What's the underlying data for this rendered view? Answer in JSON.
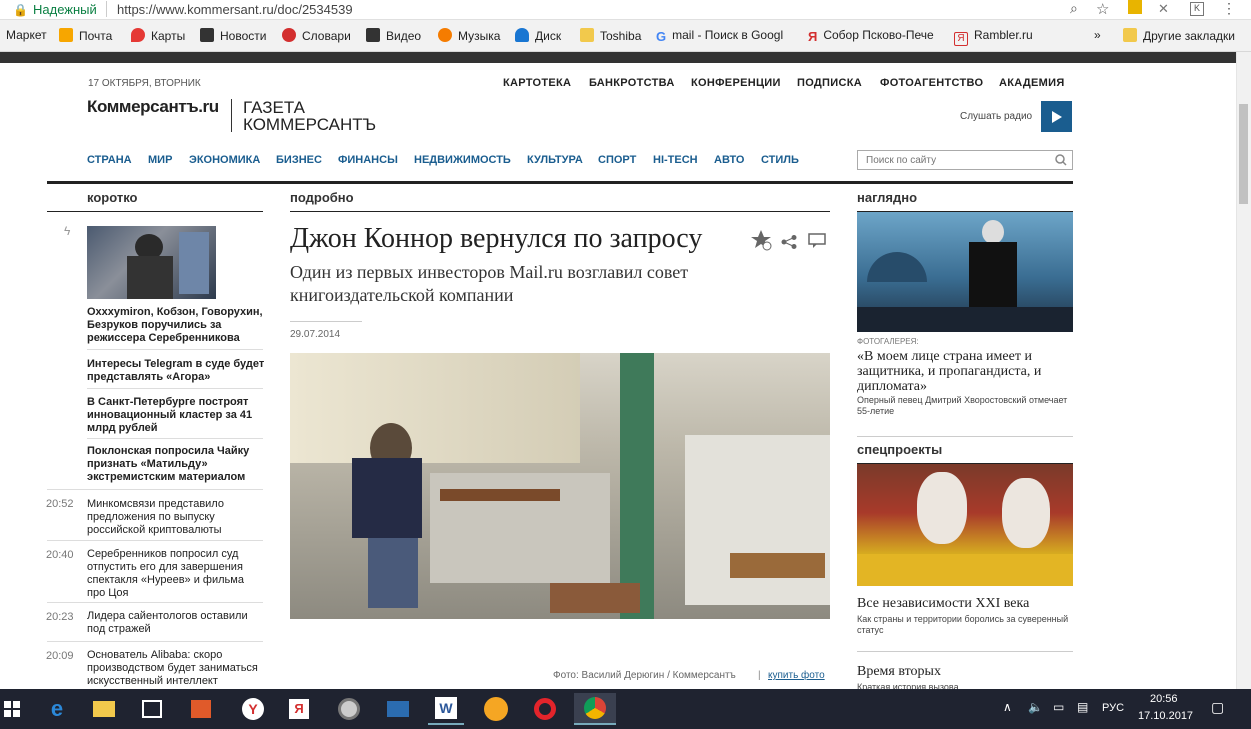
{
  "browser": {
    "secure_label": "Надежный",
    "url": "https://www.kommersant.ru/doc/2534539",
    "bookmarks": [
      "Маркет",
      "Почта",
      "Карты",
      "Новости",
      "Словари",
      "Видео",
      "Музыка",
      "Диск",
      "Toshiba",
      "mail - Поиск в Googl",
      "Собор Псково-Пече",
      "Rambler.ru"
    ],
    "more": "»",
    "other": "Другие закладки"
  },
  "site": {
    "date": "17 ОКТЯБРЯ, ВТОРНИК",
    "logo1": "Коммерсантъ.ru",
    "logo2a": "ГАЗЕТА",
    "logo2b": "КОММЕРСАНТЪ",
    "radio_label": "Слушать радио",
    "top_nav": [
      "КАРТОТЕКА",
      "БАНКРОТСТВА",
      "КОНФЕРЕНЦИИ",
      "ПОДПИСКА",
      "ФОТОАГЕНТСТВО",
      "АКАДЕМИЯ"
    ],
    "main_nav": [
      "СТРАНА",
      "МИР",
      "ЭКОНОМИКА",
      "БИЗНЕС",
      "ФИНАНСЫ",
      "НЕДВИЖИМОСТЬ",
      "КУЛЬТУРА",
      "СПОРТ",
      "HI-TECH",
      "АВТО",
      "СТИЛЬ"
    ],
    "search_placeholder": "Поиск по сайту"
  },
  "left": {
    "heading": "коротко",
    "headline_items": [
      "Oxxxymiron, Кобзон, Говорухин, Безруков поручились за режиссера Серебренникова",
      "Интересы Telegram в суде будет представлять «Агора»",
      "В Санкт-Петербурге построят инновационный кластер за 41 млрд рублей",
      "Поклонская попросила Чайку признать «Матильду» экстремистским материалом"
    ],
    "timed_items": [
      {
        "time": "20:52",
        "text": "Минкомсвязи представило предложения по выпуску российской криптовалюты"
      },
      {
        "time": "20:40",
        "text": "Серебренников попросил суд отпустить его для завершения спектакля «Нуреев» и фильма про Цоя"
      },
      {
        "time": "20:23",
        "text": "Лидера сайентологов оставили под стражей"
      },
      {
        "time": "20:09",
        "text": "Основатель Alibaba: скоро производством будет заниматься искусственный интеллект"
      }
    ]
  },
  "article": {
    "heading": "подробно",
    "title": "Джон Коннор вернулся по запросу",
    "subtitle": "Один из первых инвесторов Mail.ru возглавил совет книгоиздательской компании",
    "date": "29.07.2014",
    "photo_credit": "Фото: Василий Дерюгин / Коммерсантъ",
    "buy_photo": "купить фото",
    "separator": "|"
  },
  "right": {
    "heading": "наглядно",
    "gallery_label": "ФОТОГАЛЕРЕЯ:",
    "gallery_title": "«В моем лице страна имеет и защитника, и пропагандиста, и дипломата»",
    "gallery_desc": "Оперный певец Дмитрий Хворостовский отмечает 55-летие",
    "special_heading": "спецпроекты",
    "special_title": "Все независимости XXI века",
    "special_desc": "Как страны и территории боролись за суверенный статус",
    "special2_title": "Время вторых",
    "special2_desc": "Краткая история вызова"
  },
  "taskbar": {
    "lang": "РУС",
    "time": "20:56",
    "date": "17.10.2017"
  },
  "colors": {
    "nav_blue": "#1a5d8f",
    "radio_button": "#1a5d8f",
    "taskbar": "#1f2330"
  }
}
